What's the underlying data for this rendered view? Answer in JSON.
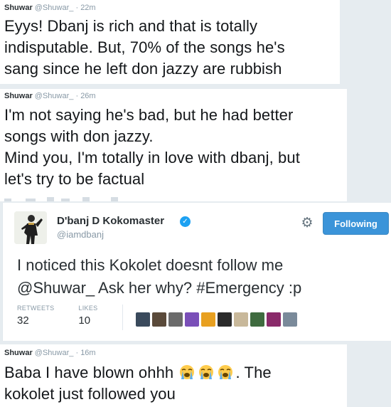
{
  "tweet1": {
    "name": "Shuwar",
    "handle": "@Shuwar_",
    "dot": "·",
    "time": "22m",
    "text": "Eyys! Dbanj is rich and that is totally\nindisputable. But, 70% of the songs he's\nsang since he left don jazzy are rubbish"
  },
  "tweet2": {
    "name": "Shuwar",
    "handle": "@Shuwar_",
    "dot": "·",
    "time": "26m",
    "text": "I'm not saying he's bad, but he had better\nsongs with don jazzy.\nMind you, I'm totally in love with dbanj, but\nlet's try to be factual"
  },
  "tweet3": {
    "display_name": "D'banj D Kokomaster",
    "handle": "@iamdbanj",
    "follow_label": "Following",
    "text": "I noticed this Kokolet doesnt follow me\n@Shuwar_ Ask her why? #Emergency :p",
    "stats": {
      "retweets_label": "RETWEETS",
      "retweets": "32",
      "likes_label": "LIKES",
      "likes": "10"
    },
    "liker_colors": [
      "#3a4a5c",
      "#5a4a3a",
      "#6b6b6b",
      "#7a4fb8",
      "#e8a020",
      "#2b2b2b",
      "#c8b89a",
      "#3f6b3f",
      "#8a2a6a",
      "#7a8a9a"
    ]
  },
  "tweet4": {
    "name": "Shuwar",
    "handle": "@Shuwar_",
    "dot": "·",
    "time": "16m",
    "text_before": "Baba I have blown ohhh",
    "text_after": ". The",
    "text_line2": "kokolet just followed you",
    "emoji_name": "loudly-crying-face",
    "emoji_count": 3
  }
}
